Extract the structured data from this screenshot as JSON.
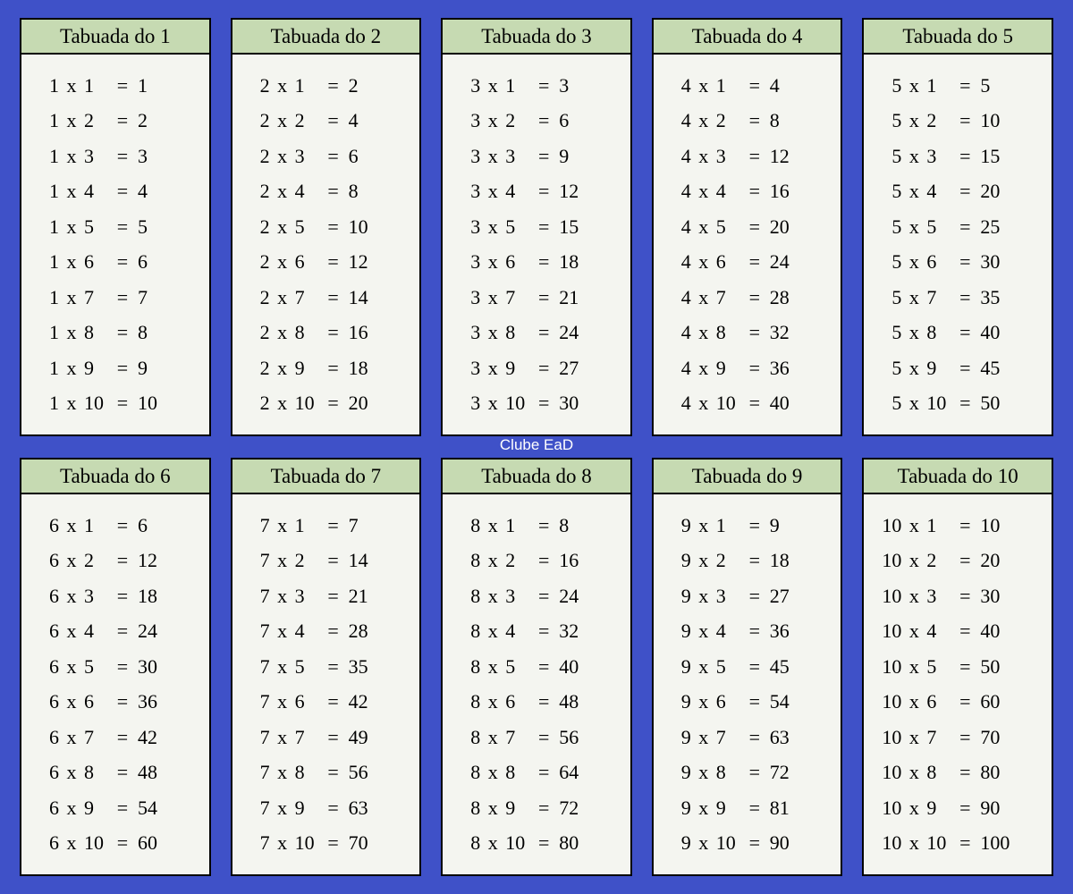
{
  "watermark": "Clube EaD",
  "title_prefix": "Tabuada do",
  "op": "x",
  "eq": "=",
  "tables": [
    {
      "n": 1,
      "rows": [
        {
          "a": 1,
          "b": 1,
          "r": 1
        },
        {
          "a": 1,
          "b": 2,
          "r": 2
        },
        {
          "a": 1,
          "b": 3,
          "r": 3
        },
        {
          "a": 1,
          "b": 4,
          "r": 4
        },
        {
          "a": 1,
          "b": 5,
          "r": 5
        },
        {
          "a": 1,
          "b": 6,
          "r": 6
        },
        {
          "a": 1,
          "b": 7,
          "r": 7
        },
        {
          "a": 1,
          "b": 8,
          "r": 8
        },
        {
          "a": 1,
          "b": 9,
          "r": 9
        },
        {
          "a": 1,
          "b": 10,
          "r": 10
        }
      ]
    },
    {
      "n": 2,
      "rows": [
        {
          "a": 2,
          "b": 1,
          "r": 2
        },
        {
          "a": 2,
          "b": 2,
          "r": 4
        },
        {
          "a": 2,
          "b": 3,
          "r": 6
        },
        {
          "a": 2,
          "b": 4,
          "r": 8
        },
        {
          "a": 2,
          "b": 5,
          "r": 10
        },
        {
          "a": 2,
          "b": 6,
          "r": 12
        },
        {
          "a": 2,
          "b": 7,
          "r": 14
        },
        {
          "a": 2,
          "b": 8,
          "r": 16
        },
        {
          "a": 2,
          "b": 9,
          "r": 18
        },
        {
          "a": 2,
          "b": 10,
          "r": 20
        }
      ]
    },
    {
      "n": 3,
      "rows": [
        {
          "a": 3,
          "b": 1,
          "r": 3
        },
        {
          "a": 3,
          "b": 2,
          "r": 6
        },
        {
          "a": 3,
          "b": 3,
          "r": 9
        },
        {
          "a": 3,
          "b": 4,
          "r": 12
        },
        {
          "a": 3,
          "b": 5,
          "r": 15
        },
        {
          "a": 3,
          "b": 6,
          "r": 18
        },
        {
          "a": 3,
          "b": 7,
          "r": 21
        },
        {
          "a": 3,
          "b": 8,
          "r": 24
        },
        {
          "a": 3,
          "b": 9,
          "r": 27
        },
        {
          "a": 3,
          "b": 10,
          "r": 30
        }
      ]
    },
    {
      "n": 4,
      "rows": [
        {
          "a": 4,
          "b": 1,
          "r": 4
        },
        {
          "a": 4,
          "b": 2,
          "r": 8
        },
        {
          "a": 4,
          "b": 3,
          "r": 12
        },
        {
          "a": 4,
          "b": 4,
          "r": 16
        },
        {
          "a": 4,
          "b": 5,
          "r": 20
        },
        {
          "a": 4,
          "b": 6,
          "r": 24
        },
        {
          "a": 4,
          "b": 7,
          "r": 28
        },
        {
          "a": 4,
          "b": 8,
          "r": 32
        },
        {
          "a": 4,
          "b": 9,
          "r": 36
        },
        {
          "a": 4,
          "b": 10,
          "r": 40
        }
      ]
    },
    {
      "n": 5,
      "rows": [
        {
          "a": 5,
          "b": 1,
          "r": 5
        },
        {
          "a": 5,
          "b": 2,
          "r": 10
        },
        {
          "a": 5,
          "b": 3,
          "r": 15
        },
        {
          "a": 5,
          "b": 4,
          "r": 20
        },
        {
          "a": 5,
          "b": 5,
          "r": 25
        },
        {
          "a": 5,
          "b": 6,
          "r": 30
        },
        {
          "a": 5,
          "b": 7,
          "r": 35
        },
        {
          "a": 5,
          "b": 8,
          "r": 40
        },
        {
          "a": 5,
          "b": 9,
          "r": 45
        },
        {
          "a": 5,
          "b": 10,
          "r": 50
        }
      ]
    },
    {
      "n": 6,
      "rows": [
        {
          "a": 6,
          "b": 1,
          "r": 6
        },
        {
          "a": 6,
          "b": 2,
          "r": 12
        },
        {
          "a": 6,
          "b": 3,
          "r": 18
        },
        {
          "a": 6,
          "b": 4,
          "r": 24
        },
        {
          "a": 6,
          "b": 5,
          "r": 30
        },
        {
          "a": 6,
          "b": 6,
          "r": 36
        },
        {
          "a": 6,
          "b": 7,
          "r": 42
        },
        {
          "a": 6,
          "b": 8,
          "r": 48
        },
        {
          "a": 6,
          "b": 9,
          "r": 54
        },
        {
          "a": 6,
          "b": 10,
          "r": 60
        }
      ]
    },
    {
      "n": 7,
      "rows": [
        {
          "a": 7,
          "b": 1,
          "r": 7
        },
        {
          "a": 7,
          "b": 2,
          "r": 14
        },
        {
          "a": 7,
          "b": 3,
          "r": 21
        },
        {
          "a": 7,
          "b": 4,
          "r": 28
        },
        {
          "a": 7,
          "b": 5,
          "r": 35
        },
        {
          "a": 7,
          "b": 6,
          "r": 42
        },
        {
          "a": 7,
          "b": 7,
          "r": 49
        },
        {
          "a": 7,
          "b": 8,
          "r": 56
        },
        {
          "a": 7,
          "b": 9,
          "r": 63
        },
        {
          "a": 7,
          "b": 10,
          "r": 70
        }
      ]
    },
    {
      "n": 8,
      "rows": [
        {
          "a": 8,
          "b": 1,
          "r": 8
        },
        {
          "a": 8,
          "b": 2,
          "r": 16
        },
        {
          "a": 8,
          "b": 3,
          "r": 24
        },
        {
          "a": 8,
          "b": 4,
          "r": 32
        },
        {
          "a": 8,
          "b": 5,
          "r": 40
        },
        {
          "a": 8,
          "b": 6,
          "r": 48
        },
        {
          "a": 8,
          "b": 7,
          "r": 56
        },
        {
          "a": 8,
          "b": 8,
          "r": 64
        },
        {
          "a": 8,
          "b": 9,
          "r": 72
        },
        {
          "a": 8,
          "b": 10,
          "r": 80
        }
      ]
    },
    {
      "n": 9,
      "rows": [
        {
          "a": 9,
          "b": 1,
          "r": 9
        },
        {
          "a": 9,
          "b": 2,
          "r": 18
        },
        {
          "a": 9,
          "b": 3,
          "r": 27
        },
        {
          "a": 9,
          "b": 4,
          "r": 36
        },
        {
          "a": 9,
          "b": 5,
          "r": 45
        },
        {
          "a": 9,
          "b": 6,
          "r": 54
        },
        {
          "a": 9,
          "b": 7,
          "r": 63
        },
        {
          "a": 9,
          "b": 8,
          "r": 72
        },
        {
          "a": 9,
          "b": 9,
          "r": 81
        },
        {
          "a": 9,
          "b": 10,
          "r": 90
        }
      ]
    },
    {
      "n": 10,
      "rows": [
        {
          "a": 10,
          "b": 1,
          "r": 10
        },
        {
          "a": 10,
          "b": 2,
          "r": 20
        },
        {
          "a": 10,
          "b": 3,
          "r": 30
        },
        {
          "a": 10,
          "b": 4,
          "r": 40
        },
        {
          "a": 10,
          "b": 5,
          "r": 50
        },
        {
          "a": 10,
          "b": 6,
          "r": 60
        },
        {
          "a": 10,
          "b": 7,
          "r": 70
        },
        {
          "a": 10,
          "b": 8,
          "r": 80
        },
        {
          "a": 10,
          "b": 9,
          "r": 90
        },
        {
          "a": 10,
          "b": 10,
          "r": 100
        }
      ]
    }
  ]
}
